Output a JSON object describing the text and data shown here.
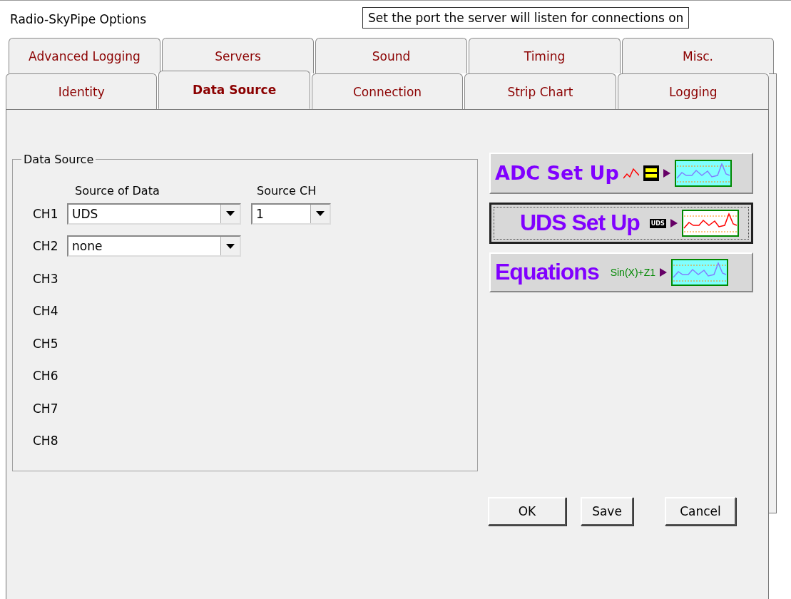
{
  "window": {
    "title": "Radio-SkyPipe Options"
  },
  "tooltip": "Set the port the server will listen for connections on",
  "back_tabs": [
    {
      "label": "Advanced Logging",
      "selected": false
    },
    {
      "label": "Servers",
      "selected": false
    },
    {
      "label": "Sound",
      "selected": false
    },
    {
      "label": "Timing",
      "selected": false
    },
    {
      "label": "Misc.",
      "selected": false
    }
  ],
  "front_tabs": [
    {
      "label": "Identity",
      "selected": false
    },
    {
      "label": "Data Source",
      "selected": true
    },
    {
      "label": "Connection",
      "selected": false
    },
    {
      "label": "Strip Chart",
      "selected": false
    },
    {
      "label": "Logging",
      "selected": false
    }
  ],
  "group": {
    "title": "Data Source",
    "source_header": "Source of Data",
    "source_ch_header": "Source CH",
    "channels": [
      {
        "label": "CH1",
        "source": "UDS",
        "source_ch": "1"
      },
      {
        "label": "CH2",
        "source": "none"
      },
      {
        "label": "CH3"
      },
      {
        "label": "CH4"
      },
      {
        "label": "CH5"
      },
      {
        "label": "CH6"
      },
      {
        "label": "CH7"
      },
      {
        "label": "CH8"
      }
    ]
  },
  "setup_buttons": [
    {
      "kind": "adc",
      "label": "ADC Set Up",
      "focused": false
    },
    {
      "kind": "uds",
      "label": "UDS Set Up",
      "chip": "UDS",
      "focused": true
    },
    {
      "kind": "equations",
      "label": "Equations",
      "formula": "Sin(X)+Z1",
      "focused": false
    }
  ],
  "buttons": [
    "OK",
    "Save",
    "Cancel"
  ]
}
